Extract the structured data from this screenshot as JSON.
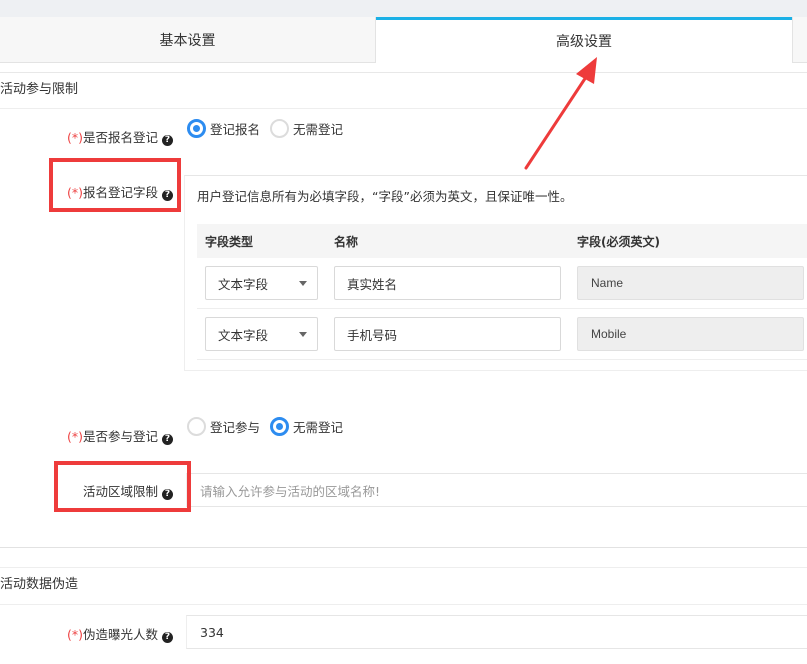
{
  "tabs": [
    {
      "label": "基本设置",
      "active": false
    },
    {
      "label": "高级设置",
      "active": true
    }
  ],
  "sections": {
    "participation": {
      "title": "活动参与限制"
    },
    "fake_data": {
      "title": "活动数据伪造"
    }
  },
  "form": {
    "required_mark": "(*)",
    "signup_registration": {
      "label": "是否报名登记",
      "options": [
        "登记报名",
        "无需登记"
      ],
      "selected": "登记报名"
    },
    "signup_fields": {
      "label": "报名登记字段",
      "hint": "用户登记信息所有为必填字段，“字段”必须为英文，且保证唯一性。",
      "columns": [
        "字段类型",
        "名称",
        "字段(必须英文)"
      ],
      "rows": [
        {
          "type": "文本字段",
          "name": "真实姓名",
          "field": "Name"
        },
        {
          "type": "文本字段",
          "name": "手机号码",
          "field": "Mobile"
        }
      ]
    },
    "participation_registration": {
      "label": "是否参与登记",
      "options": [
        "登记参与",
        "无需登记"
      ],
      "selected": "无需登记"
    },
    "region_limit": {
      "label": "活动区域限制",
      "placeholder": "请输入允许参与活动的区域名称!"
    },
    "fake_exposure": {
      "label": "伪造曝光人数",
      "value": "334"
    }
  },
  "colors": {
    "accent": "#2d8cf0",
    "active_tab_border": "#1ab0e6",
    "required": "#ee4444",
    "annotation": "#ee3b3b"
  },
  "icons": {
    "help": "question-circle-icon",
    "dropdown": "caret-down-icon",
    "annotation_arrow": "red-arrow-icon"
  }
}
